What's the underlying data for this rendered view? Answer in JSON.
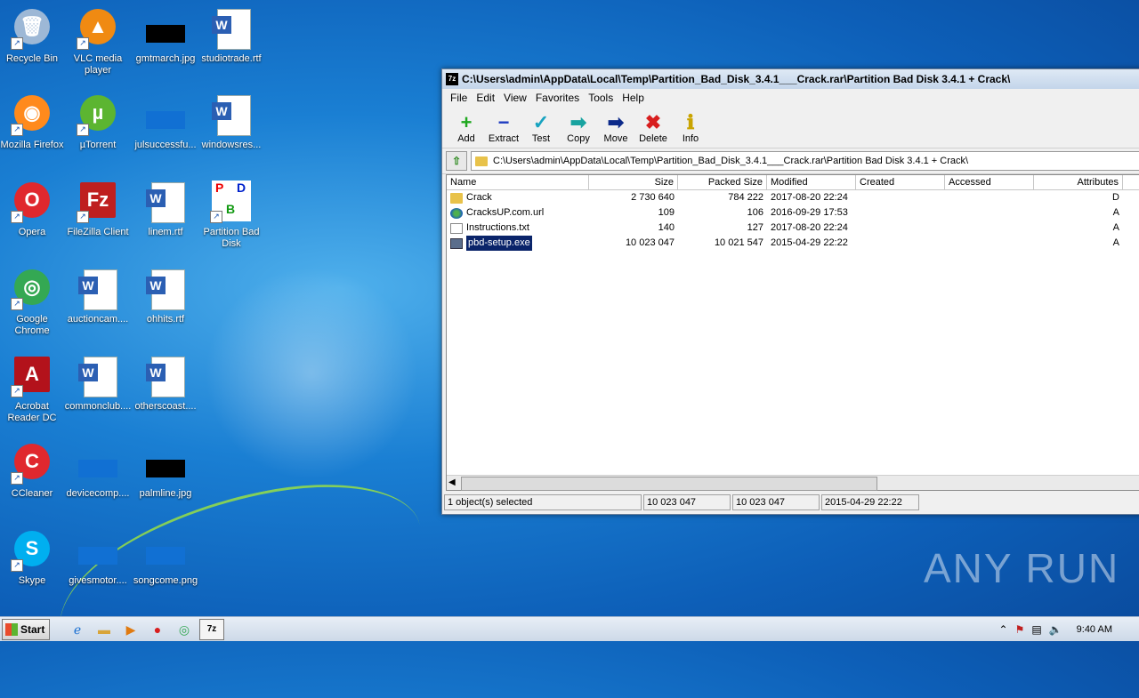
{
  "desktop": {
    "icons": [
      {
        "label": "Recycle Bin",
        "glyph": "🗑",
        "color": "#9db8d6"
      },
      {
        "label": "VLC media player",
        "glyph": "▲",
        "color": "#f08a12"
      },
      {
        "label": "gmtmarch.jpg",
        "glyph": "",
        "color": "#000000"
      },
      {
        "label": "studiotrade.rtf",
        "glyph": "W",
        "color": "#2b5fb3"
      },
      {
        "label": "Mozilla Firefox",
        "glyph": "◉",
        "color": "#ff8a1c"
      },
      {
        "label": "µTorrent",
        "glyph": "µ",
        "color": "#5cb531"
      },
      {
        "label": "julsuccessfu...",
        "glyph": "",
        "color": "#1170d3"
      },
      {
        "label": "windowsres...",
        "glyph": "W",
        "color": "#2b5fb3"
      },
      {
        "label": "Opera",
        "glyph": "O",
        "color": "#e0282e"
      },
      {
        "label": "FileZilla Client",
        "glyph": "Fz",
        "color": "#bf1f1f"
      },
      {
        "label": "linem.rtf",
        "glyph": "W",
        "color": "#2b5fb3"
      },
      {
        "label": "Partition Bad Disk",
        "glyph": "PDB",
        "color": "#ffffff"
      },
      {
        "label": "Google Chrome",
        "glyph": "◎",
        "color": "#34a853"
      },
      {
        "label": "auctioncam....",
        "glyph": "W",
        "color": "#2b5fb3"
      },
      {
        "label": "ohhits.rtf",
        "glyph": "W",
        "color": "#2b5fb3"
      },
      {
        "label": "Acrobat Reader DC",
        "glyph": "A",
        "color": "#b3121b"
      },
      {
        "label": "commonclub....",
        "glyph": "W",
        "color": "#2b5fb3"
      },
      {
        "label": "otherscoast....",
        "glyph": "W",
        "color": "#2b5fb3"
      },
      {
        "label": "CCleaner",
        "glyph": "C",
        "color": "#e0282e"
      },
      {
        "label": "devicecomp....",
        "glyph": "",
        "color": "#1170d3"
      },
      {
        "label": "palmline.jpg",
        "glyph": "",
        "color": "#000000"
      },
      {
        "label": "Skype",
        "glyph": "S",
        "color": "#00aff0"
      },
      {
        "label": "givesmotor....",
        "glyph": "",
        "color": "#1170d3"
      },
      {
        "label": "songcome.png",
        "glyph": "",
        "color": "#1170d3"
      }
    ],
    "watermark": "ANY RUN"
  },
  "window": {
    "title": "C:\\Users\\admin\\AppData\\Local\\Temp\\Partition_Bad_Disk_3.4.1___Crack.rar\\Partition Bad Disk 3.4.1 + Crack\\",
    "app_icon_text": "7z",
    "menu": [
      "File",
      "Edit",
      "View",
      "Favorites",
      "Tools",
      "Help"
    ],
    "toolbar": [
      {
        "label": "Add",
        "glyph": "+",
        "color": "#1fa81f",
        "icon": "add-icon"
      },
      {
        "label": "Extract",
        "glyph": "−",
        "color": "#1f3cc0",
        "icon": "extract-icon"
      },
      {
        "label": "Test",
        "glyph": "✓",
        "color": "#18a3c0",
        "icon": "test-icon"
      },
      {
        "label": "Copy",
        "glyph": "➡",
        "color": "#18a3a0",
        "icon": "copy-icon"
      },
      {
        "label": "Move",
        "glyph": "➡",
        "color": "#0c2a8a",
        "icon": "move-icon"
      },
      {
        "label": "Delete",
        "glyph": "✖",
        "color": "#d81e1e",
        "icon": "delete-icon"
      },
      {
        "label": "Info",
        "glyph": "ℹ",
        "color": "#c9a400",
        "icon": "info-icon"
      }
    ],
    "address": "C:\\Users\\admin\\AppData\\Local\\Temp\\Partition_Bad_Disk_3.4.1___Crack.rar\\Partition Bad Disk 3.4.1 + Crack\\",
    "columns": [
      "Name",
      "Size",
      "Packed Size",
      "Modified",
      "Created",
      "Accessed",
      "Attributes"
    ],
    "rows": [
      {
        "name": "Crack",
        "type": "folder",
        "size": "2 730 640",
        "packed": "784 222",
        "modified": "2017-08-20 22:24",
        "created": "",
        "accessed": "",
        "attr": "D"
      },
      {
        "name": "CracksUP.com.url",
        "type": "url",
        "size": "109",
        "packed": "106",
        "modified": "2016-09-29 17:53",
        "created": "",
        "accessed": "",
        "attr": "A"
      },
      {
        "name": "Instructions.txt",
        "type": "txt",
        "size": "140",
        "packed": "127",
        "modified": "2017-08-20 22:24",
        "created": "",
        "accessed": "",
        "attr": "A"
      },
      {
        "name": "pbd-setup.exe",
        "type": "exe",
        "size": "10 023 047",
        "packed": "10 021 547",
        "modified": "2015-04-29 22:22",
        "created": "",
        "accessed": "",
        "attr": "A",
        "selected": true
      }
    ],
    "status": {
      "selected": "1 object(s) selected",
      "size": "10 023 047",
      "packed": "10 023 047",
      "modified": "2015-04-29 22:22"
    }
  },
  "taskbar": {
    "start_label": "Start",
    "clock": "9:40 AM"
  }
}
